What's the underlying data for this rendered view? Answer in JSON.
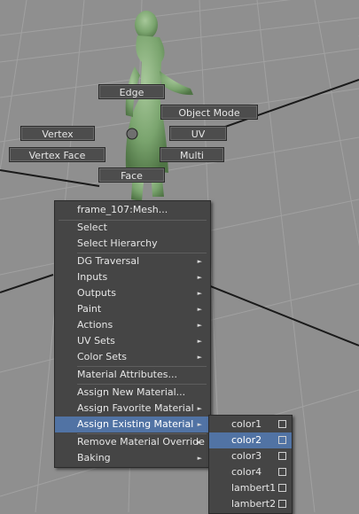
{
  "marking_menu": {
    "edge": "Edge",
    "object_mode": "Object Mode",
    "vertex": "Vertex",
    "uv": "UV",
    "vertex_face": "Vertex Face",
    "multi": "Multi",
    "face": "Face"
  },
  "context_menu": {
    "title": "frame_107:Mesh...",
    "items": [
      "Select",
      "Select Hierarchy",
      "DG Traversal",
      "Inputs",
      "Outputs",
      "Paint",
      "Actions",
      "UV Sets",
      "Color Sets",
      "Material Attributes...",
      "Assign New Material...",
      "Assign Favorite Material",
      "Assign Existing Material",
      "Remove Material Override",
      "Baking"
    ],
    "highlighted_item": "Assign Existing Material"
  },
  "submenu": {
    "items": [
      "color1",
      "color2",
      "color3",
      "color4",
      "lambert1",
      "lambert2"
    ],
    "highlighted_item": "color2"
  },
  "colors": {
    "menu_bg": "#454545",
    "highlight": "#5173a4",
    "viewport_bg": "#8f8f8f",
    "model": "#7aa46e"
  }
}
